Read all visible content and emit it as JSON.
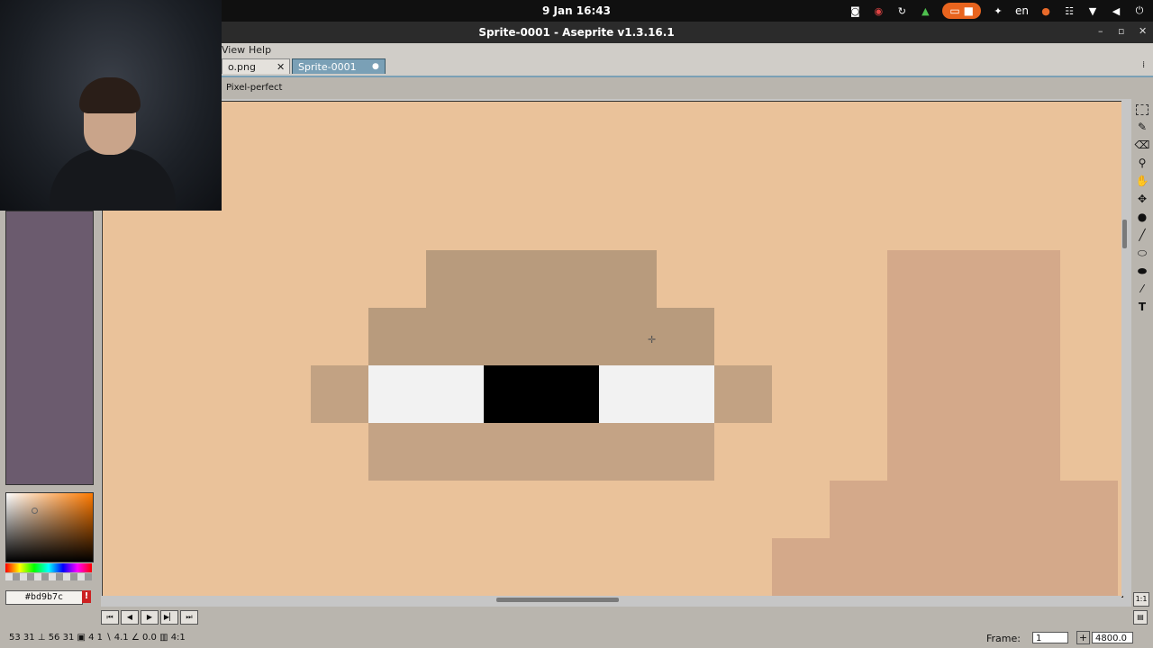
{
  "os_bar": {
    "clock": "9 Jan 16:43",
    "language": "en",
    "icons": [
      "discord-icon",
      "steam-icon",
      "sync-icon",
      "lock-icon",
      "screen-record-icon",
      "accessibility-icon",
      "mic-icon",
      "network-icon",
      "wifi-icon",
      "volume-icon",
      "power-icon"
    ]
  },
  "window": {
    "title": "Sprite-0001 - Aseprite v1.3.16.1",
    "minimize": "–",
    "maximize": "▫",
    "close": "✕"
  },
  "menu": {
    "view": "View",
    "help": "Help"
  },
  "tabs": [
    {
      "label": "o.png",
      "close": "✕"
    },
    {
      "label": "Sprite-0001",
      "modified": "●"
    }
  ],
  "context_bar": {
    "pixel_perfect": "Pixel-perfect"
  },
  "colors": {
    "foreground": "#bd9b7c",
    "background": "#cccccd",
    "accent": "#7aa0b6",
    "canvas_bg": "#eac29a"
  },
  "status": {
    "info": "53 31  ⊥ 56 31  ▣ 4 1  ∖ 4.1  ∠ 0.0  ▥ 4:1",
    "frame_label": "Frame:",
    "frame_value": "1",
    "zoom_value": "4800.0",
    "ratio": "1:1"
  },
  "tools": [
    "marquee-icon",
    "pencil-icon",
    "eraser-icon",
    "eyedropper-icon",
    "hand-icon",
    "move-icon",
    "paint-bucket-icon",
    "line-icon",
    "ellipse-icon",
    "blur-icon",
    "spray-icon",
    "text-icon"
  ]
}
